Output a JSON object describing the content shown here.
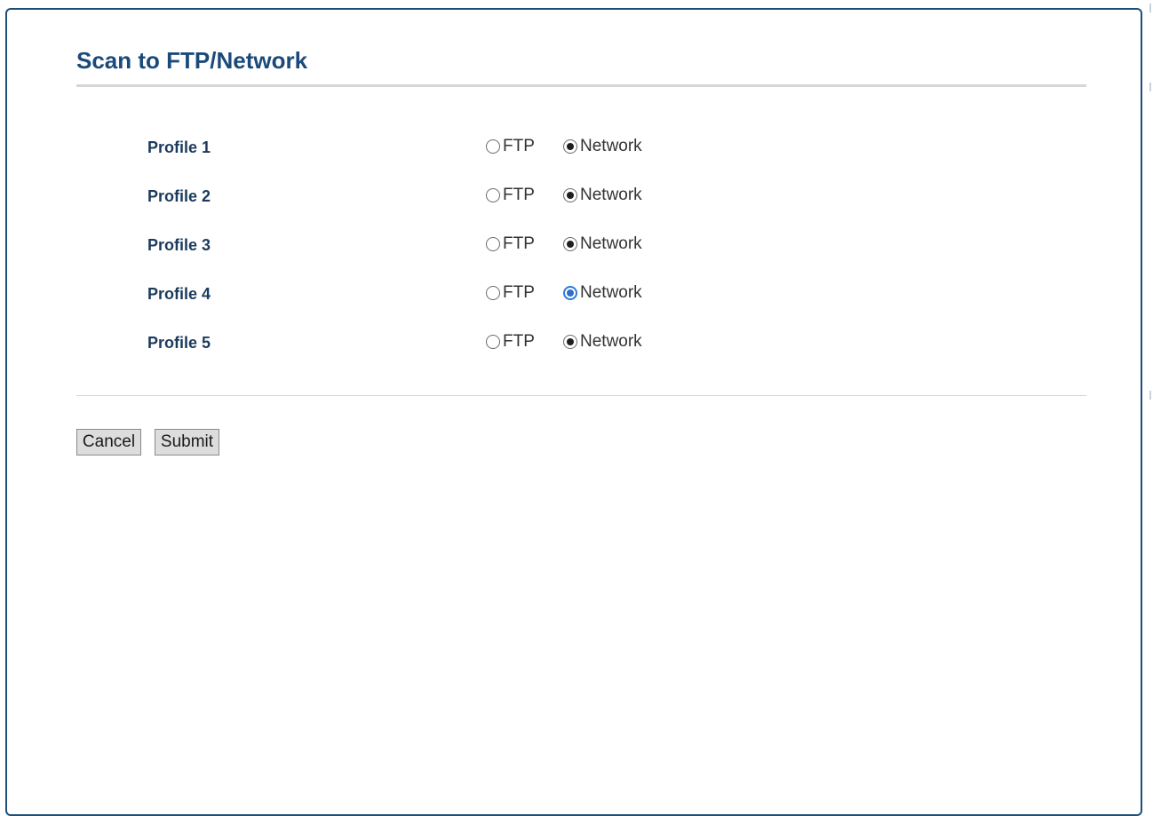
{
  "page": {
    "title": "Scan to FTP/Network"
  },
  "profiles": [
    {
      "label": "Profile 1",
      "options": [
        "FTP",
        "Network"
      ],
      "selected": "Network",
      "focused": false
    },
    {
      "label": "Profile 2",
      "options": [
        "FTP",
        "Network"
      ],
      "selected": "Network",
      "focused": false
    },
    {
      "label": "Profile 3",
      "options": [
        "FTP",
        "Network"
      ],
      "selected": "Network",
      "focused": false
    },
    {
      "label": "Profile 4",
      "options": [
        "FTP",
        "Network"
      ],
      "selected": "Network",
      "focused": true
    },
    {
      "label": "Profile 5",
      "options": [
        "FTP",
        "Network"
      ],
      "selected": "Network",
      "focused": false
    }
  ],
  "buttons": {
    "cancel_label": "Cancel",
    "submit_label": "Submit"
  },
  "colors": {
    "title": "#1b4a7a",
    "frame_border": "#1f4e79",
    "focus_accent": "#2f7ad8"
  }
}
